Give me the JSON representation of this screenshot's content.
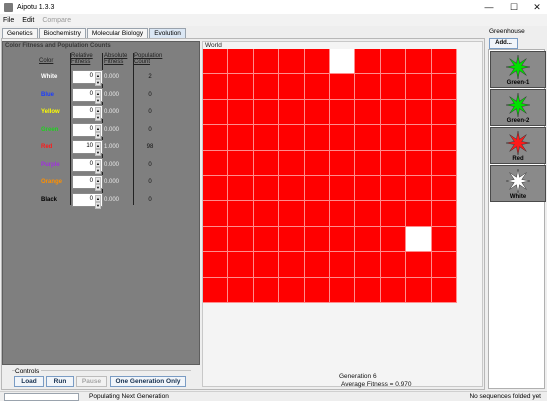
{
  "window": {
    "title": "Aipotu 1.3.3",
    "controls": [
      "—",
      "☐",
      "✕"
    ]
  },
  "menu": {
    "items": [
      "File",
      "Edit",
      "Compare"
    ]
  },
  "tabs": [
    "Genetics",
    "Biochemistry",
    "Molecular Biology",
    "Evolution"
  ],
  "fitness_panel": {
    "title": "Color Fitness and Population Counts",
    "headers": {
      "color": "Color",
      "relative_fitness": "Relative Fitness",
      "absolute_fitness": "Absolute Fitness",
      "population_count": "Population Count"
    },
    "rows": [
      {
        "color": "White",
        "color_hex": "#ffffff",
        "relative": "0",
        "absolute": "0.000",
        "count": "2"
      },
      {
        "color": "Blue",
        "color_hex": "#1a3cff",
        "relative": "0",
        "absolute": "0.000",
        "count": "0"
      },
      {
        "color": "Yellow",
        "color_hex": "#ffff00",
        "relative": "0",
        "absolute": "0.000",
        "count": "0"
      },
      {
        "color": "Green",
        "color_hex": "#1dd31d",
        "relative": "0",
        "absolute": "0.000",
        "count": "0"
      },
      {
        "color": "Red",
        "color_hex": "#ff1a1a",
        "relative": "10",
        "absolute": "1.000",
        "count": "98"
      },
      {
        "color": "Purple",
        "color_hex": "#a030e0",
        "relative": "0",
        "absolute": "0.000",
        "count": "0"
      },
      {
        "color": "Orange",
        "color_hex": "#ff9000",
        "relative": "0",
        "absolute": "0.000",
        "count": "0"
      },
      {
        "color": "Black",
        "color_hex": "#000000",
        "relative": "0",
        "absolute": "0.000",
        "count": "0"
      }
    ]
  },
  "world": {
    "title": "World",
    "rows": 10,
    "cols": 10,
    "cell_color": "#ff0000",
    "line_color": "#ff8c8c",
    "white_cells": [
      {
        "row": 0,
        "col": 5
      },
      {
        "row": 7,
        "col": 8
      }
    ],
    "generation": "Generation 6",
    "average_fitness": "Average Fitness = 0.970"
  },
  "controls": {
    "title": "Controls",
    "load": "Load",
    "run": "Run",
    "pause": "Pause",
    "one_generation": "One Generation Only"
  },
  "greenhouse": {
    "title": "Greenhouse",
    "add_label": "Add...",
    "items": [
      {
        "label": "Green-1",
        "icon": "green-star-icon",
        "color": "#00e000"
      },
      {
        "label": "Green-2",
        "icon": "green-star-icon",
        "color": "#00e000"
      },
      {
        "label": "Red",
        "icon": "red-star-icon",
        "color": "#ff1a1a"
      },
      {
        "label": "White",
        "icon": "white-star-icon",
        "color": "#ffffff"
      }
    ]
  },
  "status": {
    "left": "Populating Next Generation",
    "right": "No sequences folded yet"
  }
}
